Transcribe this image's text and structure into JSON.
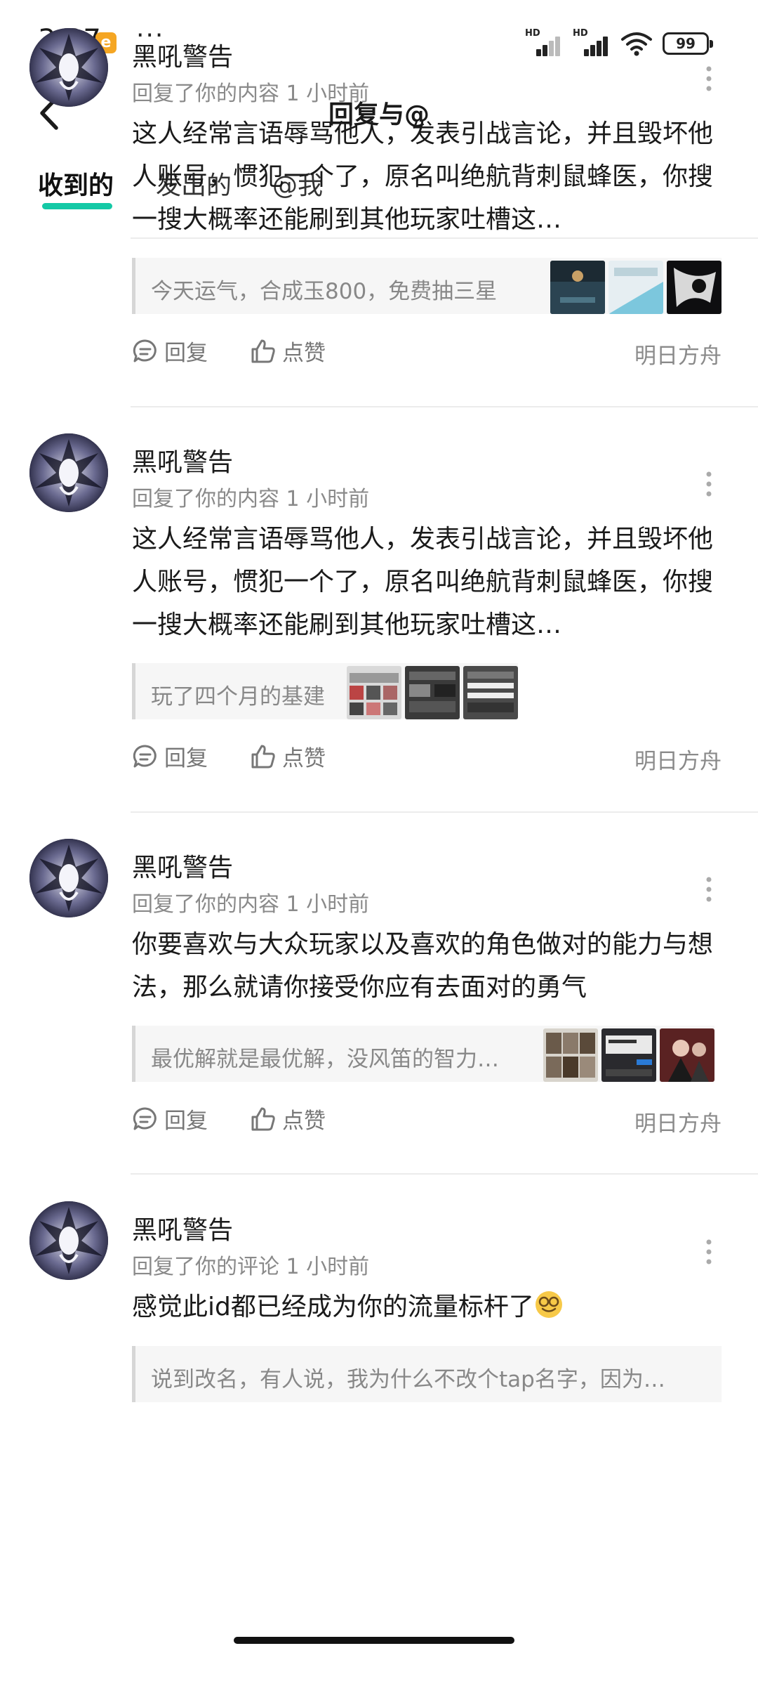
{
  "status_bar": {
    "time": "3:37",
    "app_badge": "e",
    "more": "···",
    "signal_label": "HD",
    "battery": "99"
  },
  "header": {
    "title": "回复与@"
  },
  "tabs": [
    {
      "label": "收到的",
      "active": true
    },
    {
      "label": "发出的",
      "active": false
    },
    {
      "label": "@我",
      "active": false
    }
  ],
  "accent_color": "#14c9a6",
  "items": [
    {
      "username": "黑吼警告",
      "meta": "回复了你的内容 1 小时前",
      "content": "这人经常言语辱骂他人，发表引战言论，并且毁坏他人账号，惯犯一个了，原名叫绝航背刺鼠蜂医，你搜一搜大概率还能刷到其他玩家吐槽这…",
      "quote": "今天运气，合成玉800，免费抽三星",
      "reply_label": "回复",
      "like_label": "点赞",
      "game": "明日方舟"
    },
    {
      "username": "黑吼警告",
      "meta": "回复了你的内容 1 小时前",
      "content": "这人经常言语辱骂他人，发表引战言论，并且毁坏他人账号，惯犯一个了，原名叫绝航背刺鼠蜂医，你搜一搜大概率还能刷到其他玩家吐槽这…",
      "quote": "玩了四个月的基建",
      "reply_label": "回复",
      "like_label": "点赞",
      "game": "明日方舟"
    },
    {
      "username": "黑吼警告",
      "meta": "回复了你的内容 1 小时前",
      "content": "你要喜欢与大众玩家以及喜欢的角色做对的能力与想法，那么就请你接受你应有去面对的勇气",
      "quote": "最优解就是最优解，没风笛的智力…",
      "reply_label": "回复",
      "like_label": "点赞",
      "game": "明日方舟"
    },
    {
      "username": "黑吼警告",
      "meta": "回复了你的评论 1 小时前",
      "content": "感觉此id都已经成为你的流量标杆了",
      "quote": "说到改名，有人说，我为什么不改个tap名字，因为…"
    }
  ]
}
